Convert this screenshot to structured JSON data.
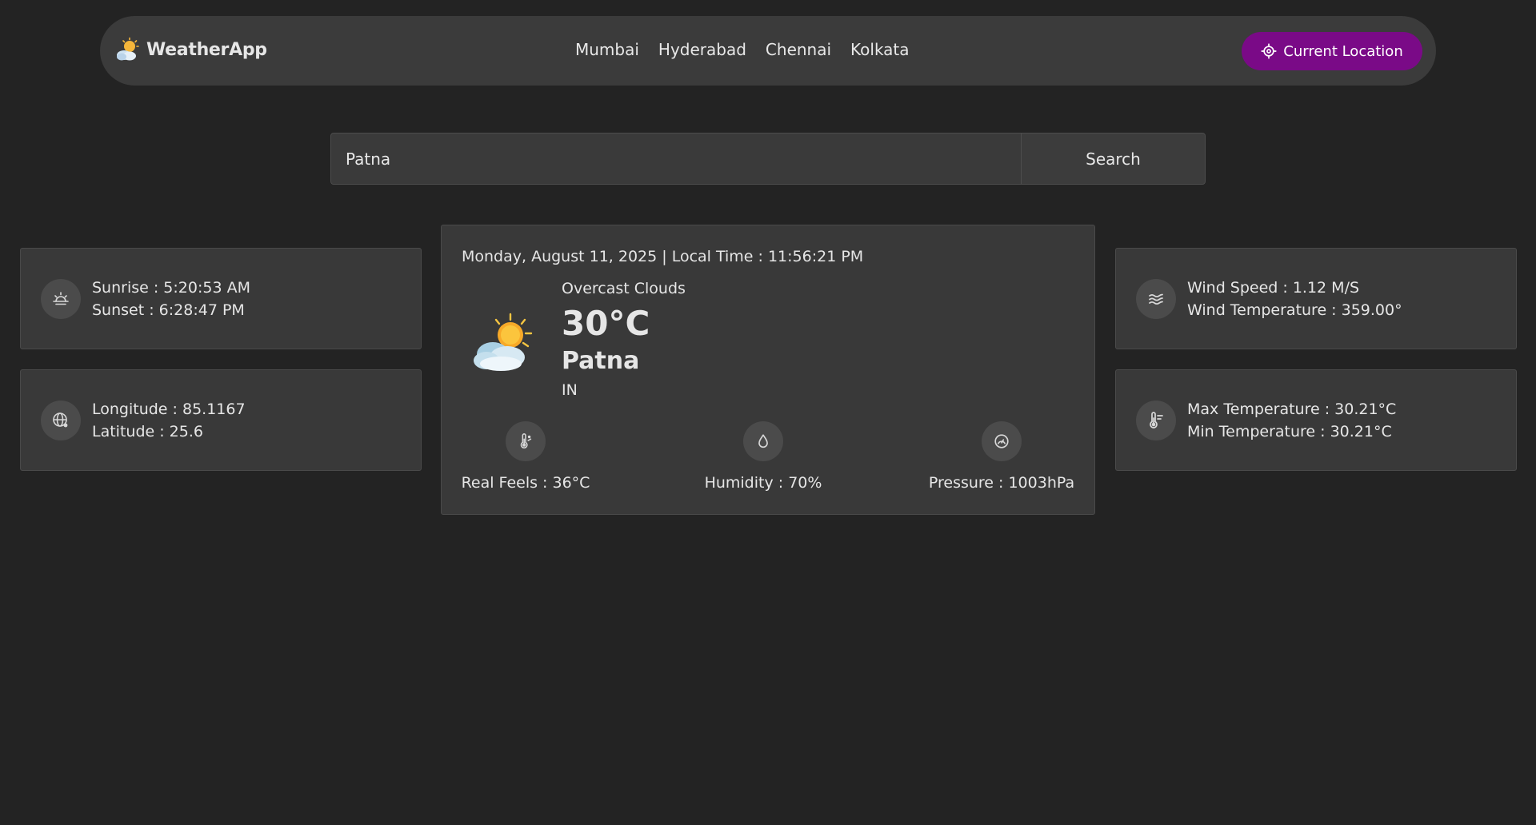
{
  "nav": {
    "brand": "WeatherApp",
    "cities": [
      "Mumbai",
      "Hyderabad",
      "Chennai",
      "Kolkata"
    ],
    "location_button": "Current Location"
  },
  "search": {
    "value": "Patna",
    "button": "Search"
  },
  "sun": {
    "sunrise": "Sunrise : 5:20:53 AM",
    "sunset": "Sunset : 6:28:47 PM"
  },
  "coords": {
    "longitude": "Longitude : 85.1167",
    "latitude": "Latitude : 25.6"
  },
  "main": {
    "datetime": "Monday, August 11, 2025 | Local Time : 11:56:21 PM",
    "description": "Overcast Clouds",
    "temperature": "30°C",
    "city": "Patna",
    "country": "IN",
    "real_feels": "Real Feels : 36°C",
    "humidity": "Humidity : 70%",
    "pressure": "Pressure : 1003hPa"
  },
  "wind": {
    "speed": "Wind Speed : 1.12 M/S",
    "temperature": "Wind Temperature : 359.00°"
  },
  "temps": {
    "max": "Max Temperature : 30.21°C",
    "min": "Min Temperature : 30.21°C"
  },
  "colors": {
    "background": "#232323",
    "card": "#393939",
    "accent": "#7a0a87"
  },
  "icons": {
    "brand": "sun-cloud-icon",
    "location": "crosshair-icon",
    "sunrise": "sunrise-icon",
    "globe": "globe-icon",
    "wind": "wind-icon",
    "thermometer": "thermometer-icon",
    "humidity": "droplet-icon",
    "pressure": "gauge-icon"
  }
}
